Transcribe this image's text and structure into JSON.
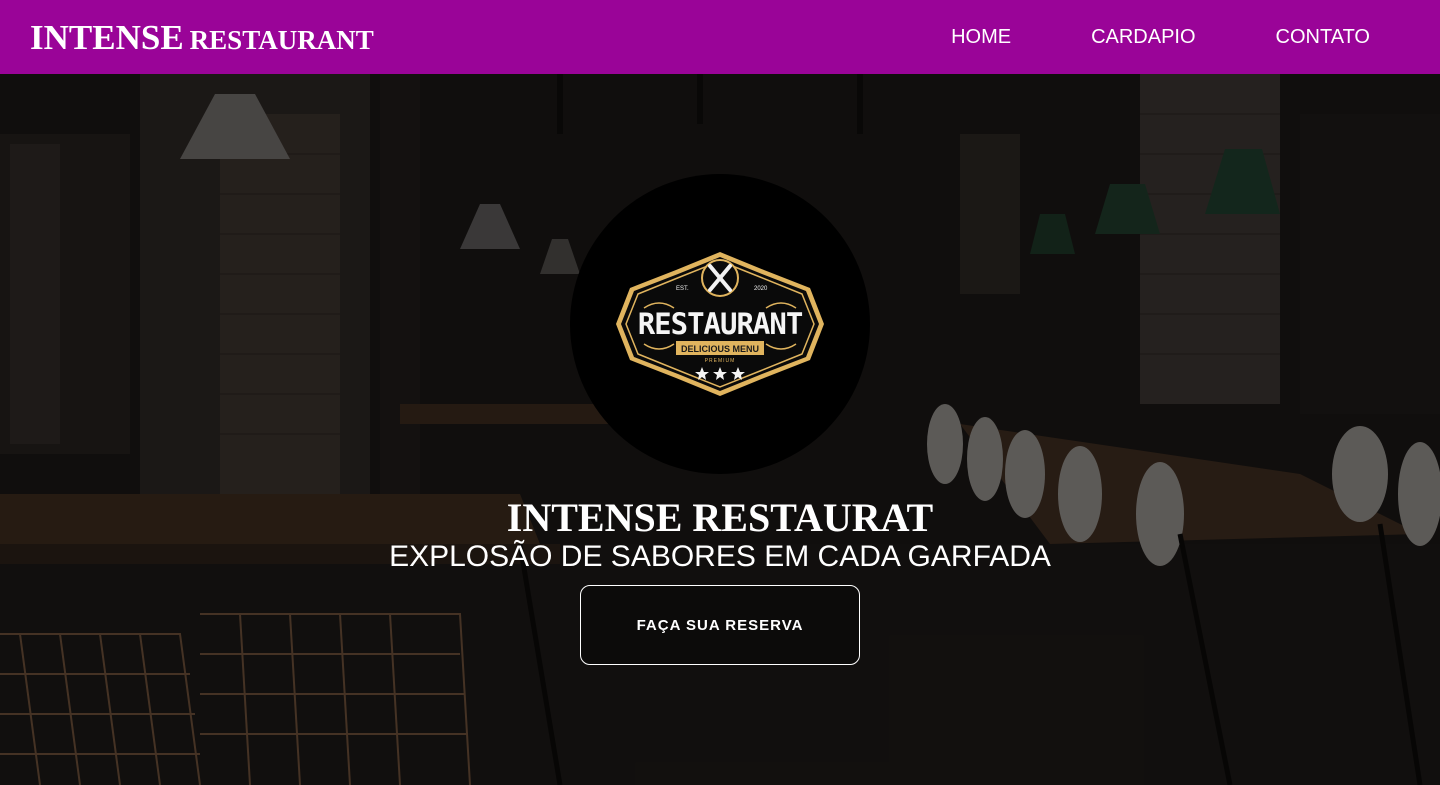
{
  "header": {
    "brand_big": "INTENSE",
    "brand_small": "RESTAURANT",
    "nav": [
      {
        "label": "HOME"
      },
      {
        "label": "CARDAPIO"
      },
      {
        "label": "CONTATO"
      }
    ]
  },
  "hero": {
    "logo": {
      "word": "RESTAURANT",
      "est": "EST.",
      "year": "2020",
      "ribbon": "DELICIOUS MENU",
      "tag": "PREMIUM"
    },
    "title": "INTENSE RESTAURAT",
    "subtitle": "EXPLOSÃO DE SABORES EM CADA GARFADA",
    "cta_label": "FAÇA SUA RESERVA"
  },
  "colors": {
    "header_bg": "#9a0498",
    "logo_gold": "#e0b45e"
  }
}
